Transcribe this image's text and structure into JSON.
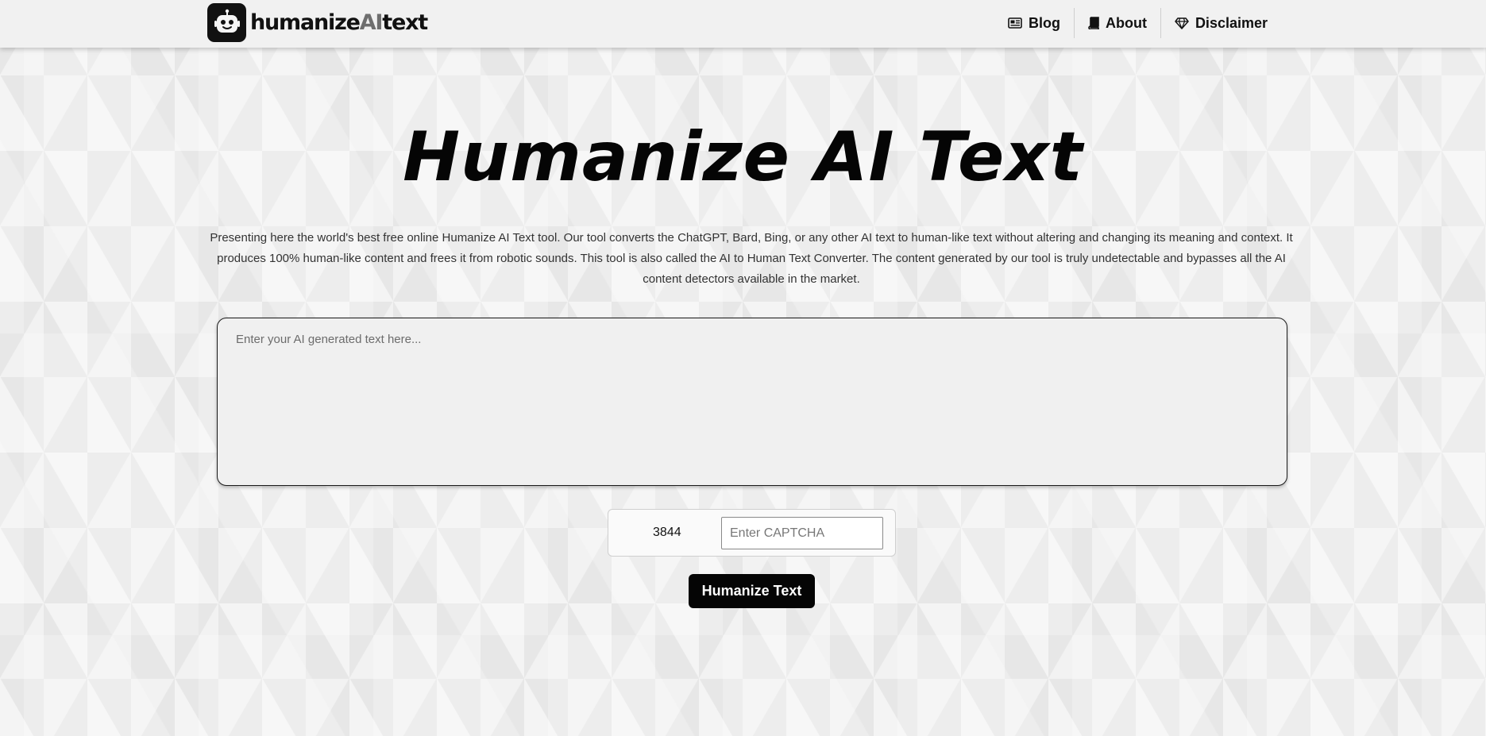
{
  "header": {
    "logo": {
      "prefix": "humanize",
      "highlight": "AI",
      "suffix": "text"
    },
    "nav": [
      {
        "label": "Blog",
        "icon": "newspaper-icon"
      },
      {
        "label": "About",
        "icon": "book-icon"
      },
      {
        "label": "Disclaimer",
        "icon": "diamond-icon"
      }
    ]
  },
  "main": {
    "title": "Humanize AI Text",
    "intro": "Presenting here the world's best free online Humanize AI Text tool. Our tool converts the ChatGPT, Bard, Bing, or any other AI text to human-like text without altering and changing its meaning and context. It produces 100% human-like content and frees it from robotic sounds. This tool is also called the AI to Human Text Converter. The content generated by our tool is truly undetectable and bypasses all the AI content detectors available in the market.",
    "input": {
      "placeholder": "Enter your AI generated text here...",
      "value": ""
    },
    "captcha": {
      "code": "3844",
      "placeholder": "Enter CAPTCHA",
      "value": ""
    },
    "submit_label": "Humanize Text"
  },
  "colors": {
    "accent": "#050505",
    "highlight": "#6e6e6e",
    "background": "#ededed",
    "header": "#f1f1f1"
  }
}
